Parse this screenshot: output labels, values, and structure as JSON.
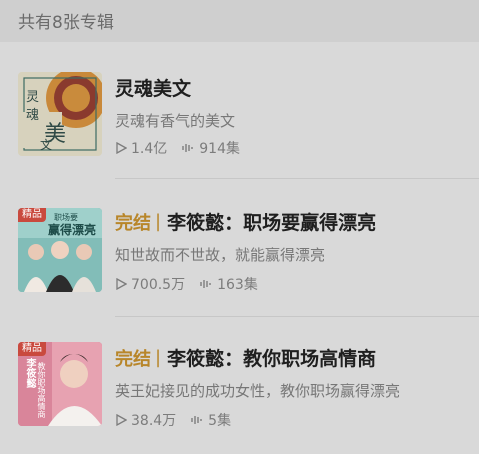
{
  "header": {
    "text": "共有8张专辑"
  },
  "albums": [
    {
      "tag": "",
      "title": "灵魂美文",
      "subtitle": "灵魂有香气的美文",
      "plays": "1.4亿",
      "episodes": "914集",
      "cover": {
        "text": [
          "灵",
          "魂",
          "美",
          "文"
        ]
      }
    },
    {
      "tag": "完结",
      "title": "李筱懿：职场要赢得漂亮",
      "subtitle": "知世故而不世故，就能赢得漂亮",
      "plays": "700.5万",
      "episodes": "163集",
      "cover": {
        "badge": "精品",
        "title": "赢得漂亮",
        "top_small": "职场要"
      }
    },
    {
      "tag": "完结",
      "title": "李筱懿：教你职场高情商",
      "subtitle": "英王妃接见的成功女性，教你职场赢得漂亮",
      "plays": "38.4万",
      "episodes": "5集",
      "cover": {
        "badge": "精品",
        "title": "教你职场高情商",
        "name": "李筱懿"
      }
    }
  ],
  "colors": {
    "tag": "#b8862a",
    "badge": "#c94a3e"
  }
}
